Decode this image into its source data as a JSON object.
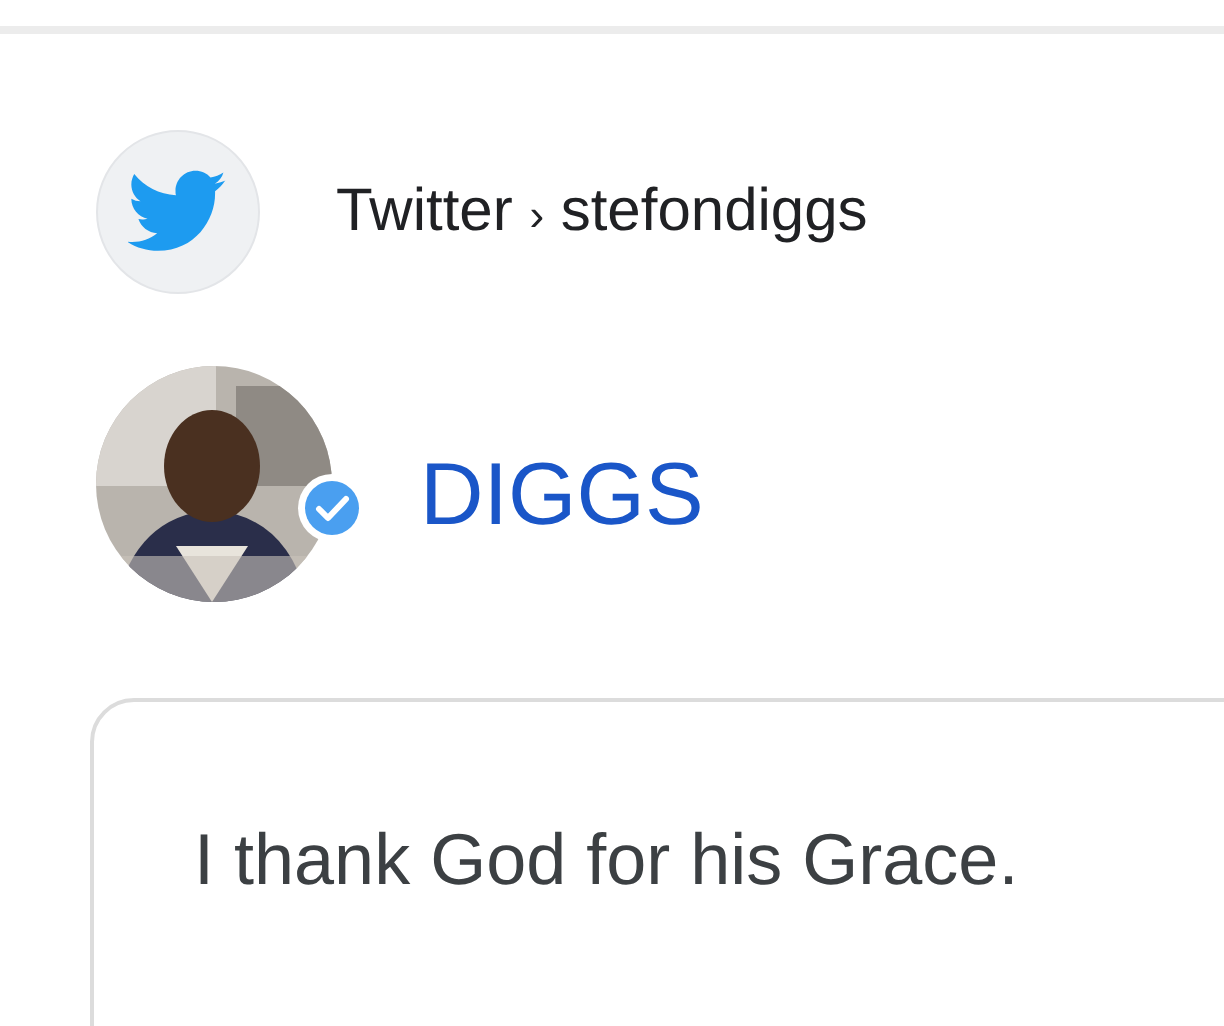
{
  "source": {
    "site": "Twitter",
    "separator": "›",
    "handle": "stefondiggs"
  },
  "account": {
    "name": "DIGGS",
    "verified": true
  },
  "tweet": {
    "text": "I thank God for his Grace."
  }
}
